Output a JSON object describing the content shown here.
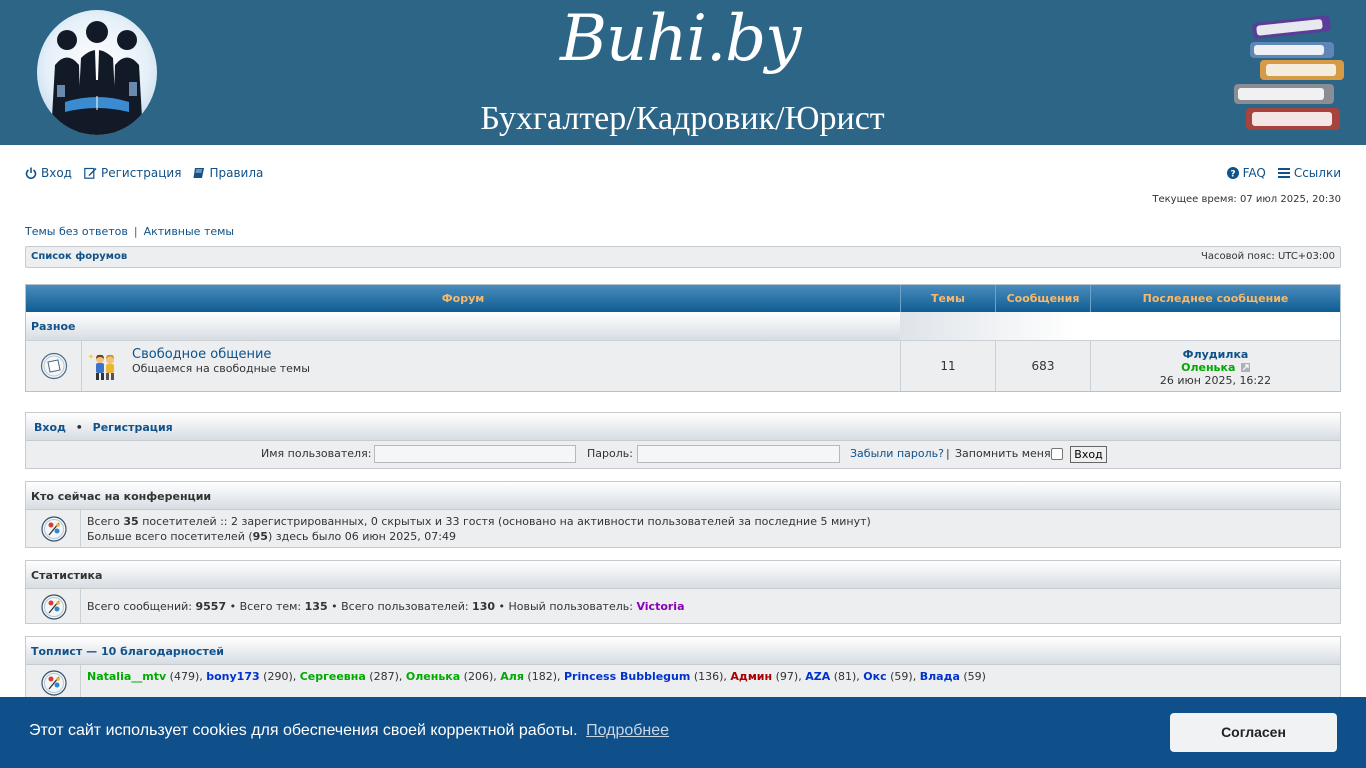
{
  "header": {
    "site_title": "Buhi.by",
    "site_subtitle": "Бухгалтер/Кадровик/Юрист"
  },
  "nav": {
    "login": "Вход",
    "register": "Регистрация",
    "rules": "Правила",
    "faq": "FAQ",
    "links": "Ссылки"
  },
  "current_time": "Текущее время: 07 июл 2025, 20:30",
  "quicklinks": {
    "unanswered": "Темы без ответов",
    "separator": "|",
    "active": "Активные темы"
  },
  "breadcrumbs": {
    "forum_index": "Список форумов",
    "timezone": "Часовой пояс: UTC+03:00"
  },
  "forum_table": {
    "headers": {
      "forum": "Форум",
      "topics": "Темы",
      "posts": "Сообщения",
      "last_post": "Последнее сообщение"
    },
    "category": "Разное",
    "forums": [
      {
        "title": "Свободное общение",
        "description": "Общаемся на свободные темы",
        "topics": "11",
        "posts": "683",
        "last_topic": "Флудилка",
        "last_author": "Оленька",
        "last_date": "26 июн 2025, 16:22"
      }
    ]
  },
  "login_box": {
    "login_link": "Вход",
    "bullet": "•",
    "register_link": "Регистрация",
    "username_label": "Имя пользователя:",
    "password_label": "Пароль:",
    "forgot": "Забыли пароль?",
    "pipe": "|",
    "remember": "Запомнить меня",
    "submit": "Вход"
  },
  "online": {
    "title": "Кто сейчас на конференции",
    "line1_pre": "Всего",
    "line1_count": "35",
    "line1_post": "посетителей :: 2 зарегистрированных, 0 скрытых и 33 гостя (основано на активности пользователей за последние 5 минут)",
    "line2_pre": "Больше всего посетителей (",
    "line2_count": "95",
    "line2_post": ") здесь было 06 июн 2025, 07:49"
  },
  "stats": {
    "title": "Статистика",
    "posts_label": "Всего сообщений:",
    "posts": "9557",
    "topics_label": "• Всего тем:",
    "topics": "135",
    "users_label": "• Всего пользователей:",
    "users": "130",
    "newest_label": "• Новый пользователь:",
    "newest": "Victoria"
  },
  "toplist": {
    "title": "Топлист — 10 благодарностей",
    "users": [
      {
        "name": "Natalia__mtv",
        "count": "(479)",
        "color": "#00aa00"
      },
      {
        "name": "bony173",
        "count": "(290)",
        "color": "#0033cc"
      },
      {
        "name": "Сергеевна",
        "count": "(287)",
        "color": "#00aa00"
      },
      {
        "name": "Оленька",
        "count": "(206)",
        "color": "#00aa00"
      },
      {
        "name": "Аля",
        "count": "(182)",
        "color": "#00aa00"
      },
      {
        "name": "Princess Bubblegum",
        "count": "(136)",
        "color": "#0033cc"
      },
      {
        "name": "Админ",
        "count": "(97)",
        "color": "#aa0000"
      },
      {
        "name": "AZA",
        "count": "(81)",
        "color": "#0033cc"
      },
      {
        "name": "Окс",
        "count": "(59)",
        "color": "#0033cc"
      },
      {
        "name": "Влада",
        "count": "(59)",
        "color": "#0033cc"
      }
    ]
  },
  "cookie": {
    "message": "Этот сайт использует cookies для обеспечения своей корректной работы.",
    "more": "Подробнее",
    "accept": "Согласен"
  },
  "colors": {
    "header_bg": "#2d6586",
    "table_head_text": "#f8b86a",
    "link": "#105289",
    "cookie_bg": "#10508a"
  }
}
